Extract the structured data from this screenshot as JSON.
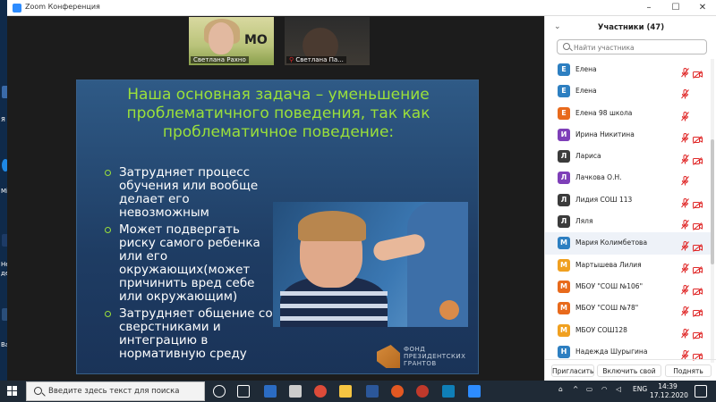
{
  "window": {
    "title": "Zoom Конференция"
  },
  "desktop": {
    "labels": [
      "Я",
      "Mi",
      "Не",
      "де",
      "Ва"
    ]
  },
  "video_tiles": [
    {
      "name": "Светлана Рахно",
      "overlay_text": "МО"
    },
    {
      "name": "Светлана Па..."
    }
  ],
  "slide": {
    "title_lines": [
      "Наша основная задача – уменьшение",
      "проблематичного поведения, так как",
      "проблематичное поведение:"
    ],
    "bullets": [
      "Затрудняет процесс обучения или вообще делает его невозможным",
      "Может подвергать риску самого ребенка или его окружающих(может причинить вред себе или окружающим)",
      "Затрудняет общение со сверстниками и интеграцию в нормативную среду"
    ],
    "logo_lines": [
      "ФОНД",
      "ПРЕЗИДЕНТСКИХ",
      "ГРАНТОВ"
    ]
  },
  "participants": {
    "header": "Участники (47)",
    "search_placeholder": "Найти участника",
    "list": [
      {
        "initial": "Е",
        "name": "Елена",
        "color": "#2d7fc1",
        "mic": "muted",
        "cam": "off"
      },
      {
        "initial": "Е",
        "name": "Елена",
        "color": "#2d7fc1",
        "mic": "muted",
        "cam": "none"
      },
      {
        "initial": "Е",
        "name": "Елена 98 школа",
        "color": "#e86a1c",
        "mic": "muted",
        "cam": "none"
      },
      {
        "initial": "И",
        "name": "Ирина Никитина",
        "color": "#7e3fb8",
        "mic": "muted",
        "cam": "off"
      },
      {
        "initial": "Л",
        "name": "Лариса",
        "color": "#3b3b3b",
        "mic": "muted",
        "cam": "off"
      },
      {
        "initial": "Л",
        "name": "Лачкова О.Н.",
        "color": "#7e3fb8",
        "mic": "muted",
        "cam": "none"
      },
      {
        "initial": "Л",
        "name": "Лидия СОШ 113",
        "color": "#3b3b3b",
        "mic": "muted",
        "cam": "off"
      },
      {
        "initial": "Л",
        "name": "Ляля",
        "color": "#3b3b3b",
        "mic": "muted",
        "cam": "off"
      },
      {
        "initial": "М",
        "name": "Мария Колимбетова",
        "color": "#2d7fc1",
        "mic": "muted",
        "cam": "off",
        "hover": true
      },
      {
        "initial": "М",
        "name": "Мартышева Лилия",
        "color": "#f0a020",
        "mic": "muted",
        "cam": "off"
      },
      {
        "initial": "М",
        "name": "МБОУ \"СОШ №106\"",
        "color": "#e86a1c",
        "mic": "muted",
        "cam": "off"
      },
      {
        "initial": "М",
        "name": "МБОУ \"СОШ №78\"",
        "color": "#e86a1c",
        "mic": "muted",
        "cam": "off"
      },
      {
        "initial": "М",
        "name": "МБОУ СОШ128",
        "color": "#f0a020",
        "mic": "muted",
        "cam": "off"
      },
      {
        "initial": "Н",
        "name": "Надежда Шурыгина",
        "color": "#2d7fc1",
        "mic": "muted",
        "cam": "off"
      }
    ],
    "footer": {
      "invite": "Пригласить",
      "unmute_all": "Включить свой звук",
      "raise_hand": "Поднять руку"
    }
  },
  "taskbar": {
    "search_text": "Введите здесь текст для поиска",
    "lang": "ENG",
    "time": "14:39",
    "date": "17.12.2020"
  },
  "colors": {
    "slide_title": "#9be03a",
    "muted_red": "#e02828",
    "taskbar": "#1f2a36"
  }
}
